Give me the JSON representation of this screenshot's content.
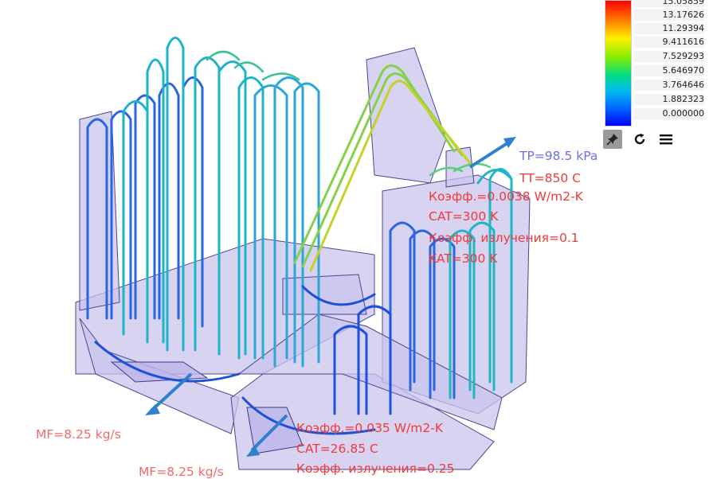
{
  "legend": {
    "values": [
      "15.05859",
      "13.17626",
      "11.29394",
      "9.411616",
      "7.529293",
      "5.646970",
      "3.764646",
      "1.882323",
      "0.000000"
    ]
  },
  "toolbar": {
    "pin_icon": "pin-icon",
    "refresh_icon": "refresh-icon",
    "menu_icon": "hamburger-menu-icon"
  },
  "annotations": {
    "pressure": "TP=98.5 kPa",
    "temperature": "TT=850 C",
    "coef_upper": "Коэфф.=0.0038 W/m2-K",
    "cat_upper": "CAT=300 K",
    "emissivity_upper": "Коэфф. излучения=0.1",
    "kat_upper": "KAT=300 K",
    "mass_flow_1": "MF=8.25 kg/s",
    "mass_flow_2": "MF=8.25 kg/s",
    "coef_lower": "Коэфф.=0.035 W/m2-K",
    "cat_lower": "CAT=26.85 C",
    "emissivity_lower": "Коэфф. излучения=0.25"
  },
  "colors": {
    "annotation_red": "#f03a3a",
    "annotation_lavender": "#6f6fe0",
    "body_fill": "#c9c4ec",
    "body_stroke": "#4a4690",
    "flow_arrow": "#2f7fd0"
  }
}
